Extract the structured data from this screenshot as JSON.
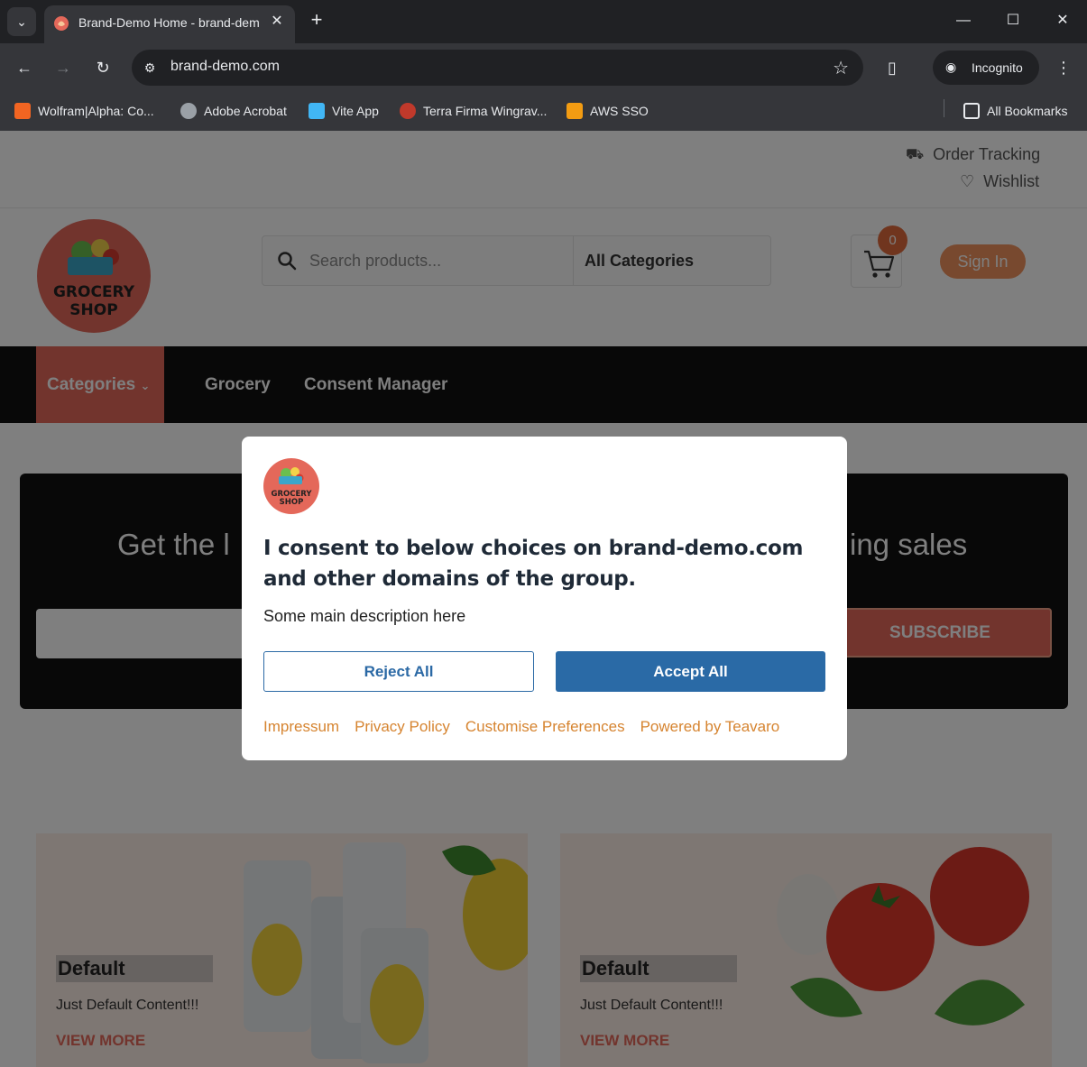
{
  "browser": {
    "tab_title": "Brand-Demo Home - brand-demo.com",
    "tab_close": "✕",
    "new_tab": "+",
    "url": "brand-demo.com",
    "profile_label": "Incognito",
    "bookmarks": [
      {
        "label": "Wolfram|Alpha: Co...",
        "color": "#f26522"
      },
      {
        "label": "Adobe Acrobat",
        "color": "#9aa0a6"
      },
      {
        "label": "Vite App",
        "color": "#41b6f5"
      },
      {
        "label": "Terra Firma Wingrav...",
        "color": "#c0392b"
      },
      {
        "label": "AWS SSO",
        "color": "#f39c12"
      }
    ],
    "all_bookmarks": "All Bookmarks"
  },
  "site": {
    "topbar": {
      "order_tracking": "Order Tracking",
      "wishlist": "Wishlist"
    },
    "logo": {
      "line1": "GROCERY",
      "line2": "SHOP"
    },
    "search": {
      "placeholder": "Search products...",
      "category": "All Categories"
    },
    "cart_count": "0",
    "signin_label": "Sign In",
    "nav": {
      "categories": "Categories",
      "links": [
        "Grocery",
        "Consent Manager"
      ]
    },
    "newsletter": {
      "title_left": "Get the l",
      "title_right": "ing sales",
      "button": "SUBSCRIBE"
    },
    "cards": [
      {
        "title": "Default",
        "text": "Just Default Content!!!",
        "link": "VIEW MORE"
      },
      {
        "title": "Default",
        "text": "Just Default Content!!!",
        "link": "VIEW MORE"
      }
    ]
  },
  "consent": {
    "title": "I consent to below choices on brand-demo.com and other domains of the group.",
    "description": "Some main description here",
    "reject_label": "Reject All",
    "accept_label": "Accept All",
    "links": [
      "Impressum",
      "Privacy Policy",
      "Customise Preferences",
      "Powered by Teavaro"
    ]
  },
  "colors": {
    "accent": "#e4685a",
    "primary_button": "#2a6aa6",
    "link": "#d68430"
  }
}
